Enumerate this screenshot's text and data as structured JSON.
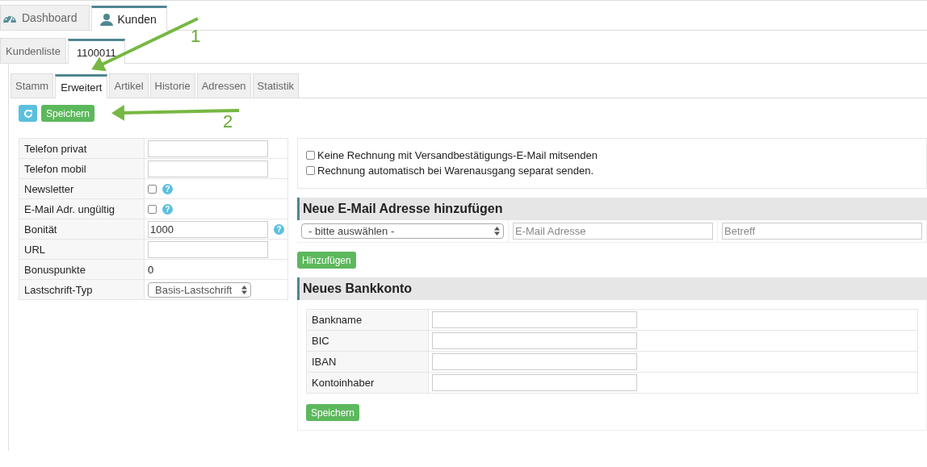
{
  "main_tabs": [
    {
      "label": "Dashboard",
      "selected": false
    },
    {
      "label": "Kunden",
      "selected": true
    }
  ],
  "record_tabs": [
    {
      "label": "Kundenliste",
      "selected": false
    },
    {
      "label": "1100011",
      "selected": true
    }
  ],
  "section_tabs": [
    {
      "label": "Stamm",
      "selected": false
    },
    {
      "label": "Erweitert",
      "selected": true
    },
    {
      "label": "Artikel",
      "selected": false
    },
    {
      "label": "Historie",
      "selected": false
    },
    {
      "label": "Adressen",
      "selected": false
    },
    {
      "label": "Statistik",
      "selected": false
    }
  ],
  "toolbar": {
    "save_button": "Speichern"
  },
  "fields": [
    {
      "kind": "input",
      "label": "Telefon privat"
    },
    {
      "kind": "input",
      "label": "Telefon mobil"
    },
    {
      "kind": "checkbox",
      "label": "Newsletter",
      "checked": false,
      "help": "?"
    },
    {
      "kind": "checkbox",
      "label": "E-Mail Adr. ungültig",
      "checked": false,
      "help": "?"
    },
    {
      "kind": "input",
      "label": "Bonität",
      "value": "1000",
      "help": "?"
    },
    {
      "kind": "input",
      "label": "URL"
    },
    {
      "kind": "static",
      "label": "Bonuspunkte",
      "value": "0"
    },
    {
      "kind": "select",
      "label": "Lastschrift-Typ",
      "value": "Basis-Lastschrift"
    }
  ],
  "invoice_options": [
    {
      "label": "Keine Rechnung mit Versandbestätigungs-E-Mail mitsenden",
      "checked": false
    },
    {
      "label": "Rechnung automatisch bei Warenausgang separat senden.",
      "checked": false
    }
  ],
  "email_section": {
    "title": "Neue E-Mail Adresse hinzufügen",
    "select": "- bitte auswählen -",
    "address_placeholder": "E-Mail Adresse",
    "subject_placeholder": "Betreff",
    "add_button": "Hinzufügen"
  },
  "bank_section": {
    "title": "Neues Bankkonto",
    "fields": [
      {
        "label": "Bankname"
      },
      {
        "label": "BIC"
      },
      {
        "label": "IBAN"
      },
      {
        "label": "Kontoinhaber"
      }
    ],
    "save_button": "Speichern"
  },
  "annotations": [
    {
      "label": "1"
    },
    {
      "label": "2"
    }
  ]
}
